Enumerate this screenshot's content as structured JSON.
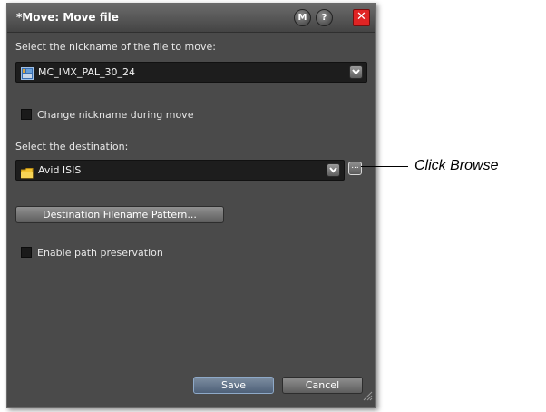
{
  "window": {
    "title": "*Move: Move file",
    "buttons": {
      "macro": "M",
      "help": "?",
      "close": "✕"
    }
  },
  "file": {
    "label": "Select the nickname of the file to move:",
    "selected": "MC_IMX_PAL_30_24"
  },
  "change_nickname": {
    "label": "Change nickname during move",
    "checked": false
  },
  "destination": {
    "label": "Select the destination:",
    "selected": "Avid ISIS",
    "browse_label": "..."
  },
  "pattern_button": {
    "label": "Destination Filename Pattern..."
  },
  "path_preservation": {
    "label": "Enable path preservation",
    "checked": false
  },
  "footer": {
    "save_label": "Save",
    "cancel_label": "Cancel"
  },
  "callout": {
    "text": "Click Browse"
  },
  "colors": {
    "close_button": "#e02424",
    "folder_icon": "#f2c230",
    "dialog_bg": "#4a4a4a"
  }
}
